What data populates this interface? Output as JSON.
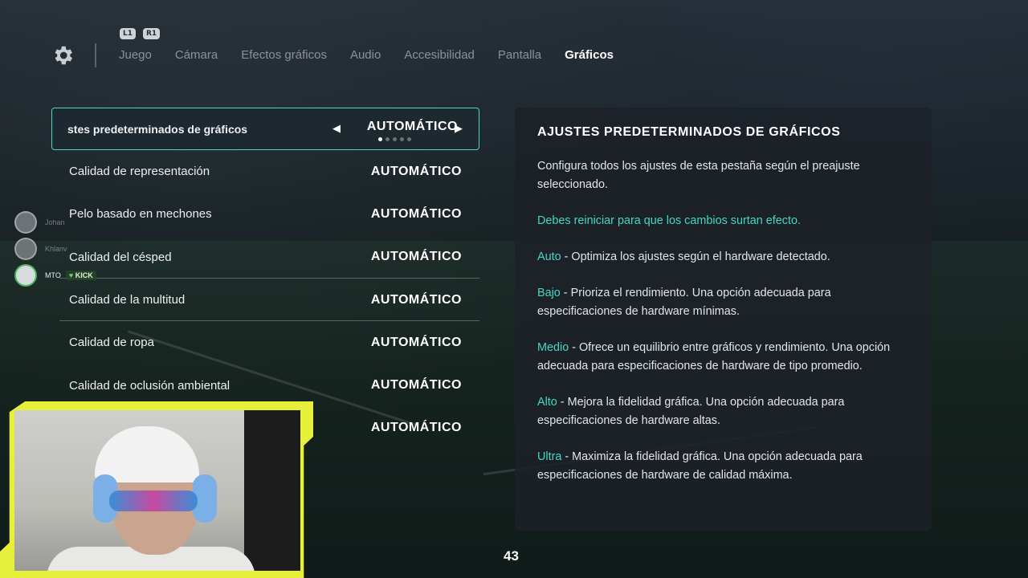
{
  "nav": {
    "bumpers": [
      "L1",
      "R1"
    ],
    "tabs": [
      {
        "label": "Juego"
      },
      {
        "label": "Cámara"
      },
      {
        "label": "Efectos gráficos"
      },
      {
        "label": "Audio"
      },
      {
        "label": "Accesibilidad"
      },
      {
        "label": "Pantalla"
      },
      {
        "label": "Gráficos",
        "active": true
      }
    ]
  },
  "settings": [
    {
      "label": "stes predeterminados de gráficos",
      "value": "AUTOMÁTICO",
      "selected": true
    },
    {
      "label": "Calidad de representación",
      "value": "AUTOMÁTICO"
    },
    {
      "label": "Pelo basado en mechones",
      "value": "AUTOMÁTICO"
    },
    {
      "label": "Calidad del césped",
      "value": "AUTOMÁTICO"
    },
    {
      "label": "Calidad de la multitud",
      "value": "AUTOMÁTICO"
    },
    {
      "label": "Calidad de ropa",
      "value": "AUTOMÁTICO"
    },
    {
      "label": "Calidad de oclusión ambiental",
      "value": "AUTOMÁTICO"
    },
    {
      "label": "",
      "value": "AUTOMÁTICO"
    }
  ],
  "friends": [
    {
      "name": "Johan"
    },
    {
      "name": "Khlanv"
    },
    {
      "name": "MTO",
      "badge": "KICK"
    }
  ],
  "panel": {
    "title": "AJUSTES PREDETERMINADOS DE GRÁFICOS",
    "intro": "Configura todos los ajustes de esta pestaña según el preajuste seleccionado.",
    "warning": "Debes reiniciar para que los cambios surtan efecto.",
    "options": [
      {
        "term": "Auto",
        "desc": " - Optimiza los ajustes según el hardware detectado."
      },
      {
        "term": "Bajo",
        "desc": " - Prioriza el rendimiento. Una opción adecuada para especificaciones de hardware mínimas."
      },
      {
        "term": "Medio",
        "desc": " - Ofrece un equilibrio entre gráficos y rendimiento. Una opción adecuada para especificaciones de hardware de tipo promedio."
      },
      {
        "term": "Alto",
        "desc": " - Mejora la fidelidad gráfica. Una opción adecuada para especificaciones de hardware altas."
      },
      {
        "term": "Ultra",
        "desc": " - Maximiza la fidelidad gráfica. Una opción adecuada para especificaciones de hardware de calidad máxima."
      }
    ]
  },
  "page_number": "43",
  "colors": {
    "accent": "#45d6c6",
    "webcam_frame": "#e6f03a"
  }
}
